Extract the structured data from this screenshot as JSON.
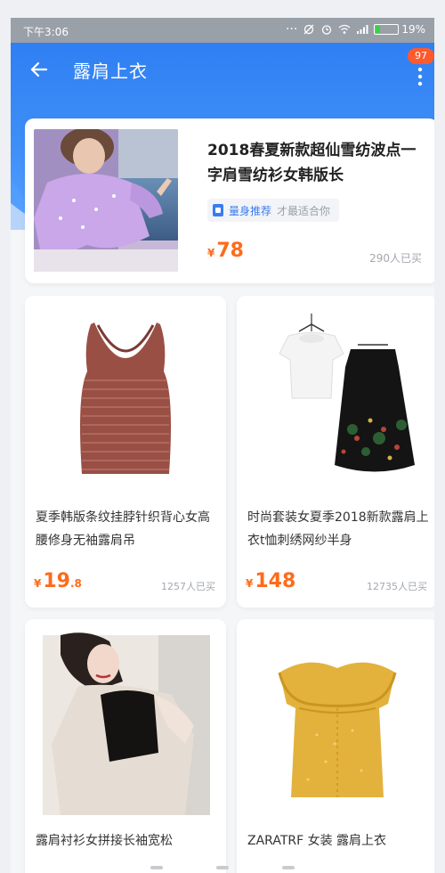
{
  "status_bar": {
    "time": "下午3:06",
    "battery": "19%",
    "battery_level": 0.19
  },
  "header": {
    "title": "露肩上衣",
    "badge": "97",
    "colors": {
      "primary": "#2f7ff3",
      "price": "#ff6a1a"
    }
  },
  "featured": {
    "title": "2018春夏新款超仙雪纺波点一字肩雪纺衫女韩版长",
    "tag_primary": "量身推荐",
    "tag_secondary": "才最适合你",
    "price_currency": "¥",
    "price_value": "78",
    "sold": "290人已买"
  },
  "products": [
    {
      "title": "夏季韩版条纹挂脖针织背心女高腰修身无袖露肩吊",
      "price_currency": "¥",
      "price_value": "19",
      "price_decimal": ".8",
      "sold": "1257人已买",
      "image_icon": "knit-tank-top"
    },
    {
      "title": "时尚套装女夏季2018新款露肩上衣t恤刺绣网纱半身",
      "price_currency": "¥",
      "price_value": "148",
      "price_decimal": "",
      "sold": "12735人已买",
      "image_icon": "tshirt-skirt-set"
    },
    {
      "title": "露肩衬衫女拼接长袖宽松",
      "image_icon": "off-shoulder-shirt-photo"
    },
    {
      "title": "ZARATRF 女装 露肩上衣",
      "image_icon": "yellow-ruffle-top"
    }
  ]
}
